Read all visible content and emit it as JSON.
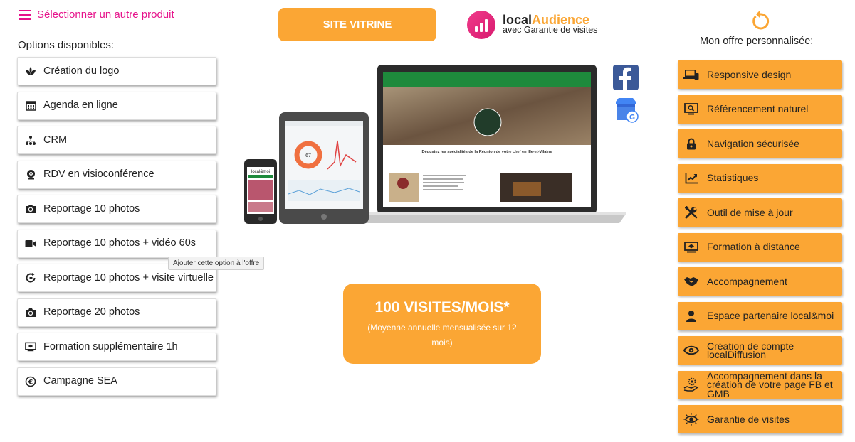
{
  "header": {
    "select_product": "Sélectionner un autre produit",
    "site_button": "SITE VITRINE",
    "brand": {
      "name_part1": "local",
      "name_part2": "Audience",
      "tagline": "avec Garantie de visites"
    }
  },
  "options": {
    "title": "Options disponibles:",
    "items": [
      {
        "label": "Création du logo",
        "icon": "leaves-icon"
      },
      {
        "label": "Agenda en ligne",
        "icon": "calendar-icon"
      },
      {
        "label": "CRM",
        "icon": "org-chart-icon"
      },
      {
        "label": "RDV en visioconférence",
        "icon": "webcam-icon"
      },
      {
        "label": "Reportage 10 photos",
        "icon": "camera-icon"
      },
      {
        "label": "Reportage 10 photos + vidéo 60s",
        "icon": "video-camera-icon"
      },
      {
        "label": "Reportage 10 photos + visite virtuelle",
        "icon": "virtual-tour-icon"
      },
      {
        "label": "Reportage 20 photos",
        "icon": "camera-icon"
      },
      {
        "label": "Formation supplémentaire 1h",
        "icon": "training-screen-icon"
      },
      {
        "label": "Campagne SEA",
        "icon": "sea-icon"
      }
    ],
    "tooltip": "Ajouter cette option à l'offre"
  },
  "offer": {
    "title": "Mon offre personnalisée:",
    "items": [
      {
        "label": "Responsive design",
        "icon": "devices-icon"
      },
      {
        "label": "Référencement naturel",
        "icon": "seo-monitor-icon"
      },
      {
        "label": "Navigation sécurisée",
        "icon": "lock-icon"
      },
      {
        "label": "Statistiques",
        "icon": "chart-icon"
      },
      {
        "label": "Outil de mise à jour",
        "icon": "tools-icon"
      },
      {
        "label": "Formation à distance",
        "icon": "remote-training-icon"
      },
      {
        "label": "Accompagnement",
        "icon": "handshake-icon"
      },
      {
        "label": "Espace partenaire local&moi",
        "icon": "user-icon"
      },
      {
        "label": "Création de compte localDiffusion",
        "icon": "eye-icon"
      },
      {
        "label": "Accompagnement dans la création de votre page FB et GMB",
        "icon": "hand-gear-icon"
      },
      {
        "label": "Garantie de visites",
        "icon": "eye-rays-icon"
      }
    ]
  },
  "visits": {
    "title": "100 VISITES/MOIS*",
    "note": "(Moyenne annuelle mensualisée sur 12 mois)"
  },
  "mockup": {
    "headline": "Dégustez les spécialités de la Réunion de votre chef en Ille-et-Vilaine",
    "gauge_value": "67",
    "phone_brand": "local&moi"
  },
  "colors": {
    "accent": "#fba634",
    "brand_pink": "#e6138b",
    "site_green": "#1e8a3c"
  }
}
